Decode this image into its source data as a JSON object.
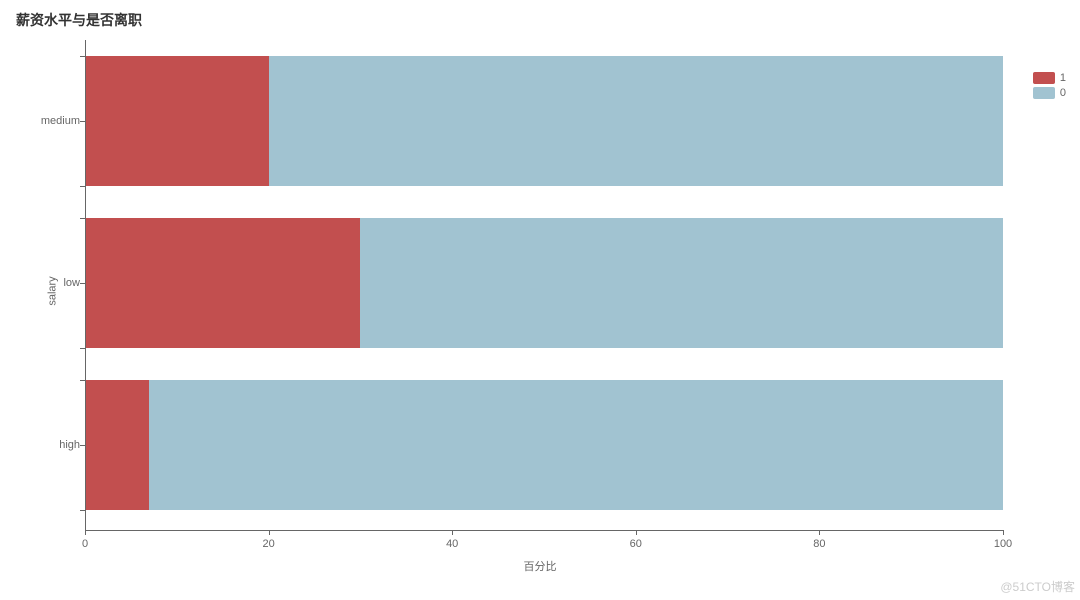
{
  "chart_data": {
    "type": "bar",
    "orientation": "horizontal",
    "stacked": true,
    "title": "薪资水平与是否离职",
    "xlabel": "百分比",
    "ylabel": "salary",
    "xlim": [
      0,
      100
    ],
    "x_ticks": [
      0,
      20,
      40,
      60,
      80,
      100
    ],
    "categories": [
      "medium",
      "low",
      "high"
    ],
    "series": [
      {
        "name": "1",
        "color": "#C24F4F",
        "values": [
          20,
          30,
          7
        ]
      },
      {
        "name": "0",
        "color": "#A1C3D1",
        "values": [
          80,
          70,
          93
        ]
      }
    ],
    "legend_position": "right"
  },
  "watermark": "@51CTO博客"
}
